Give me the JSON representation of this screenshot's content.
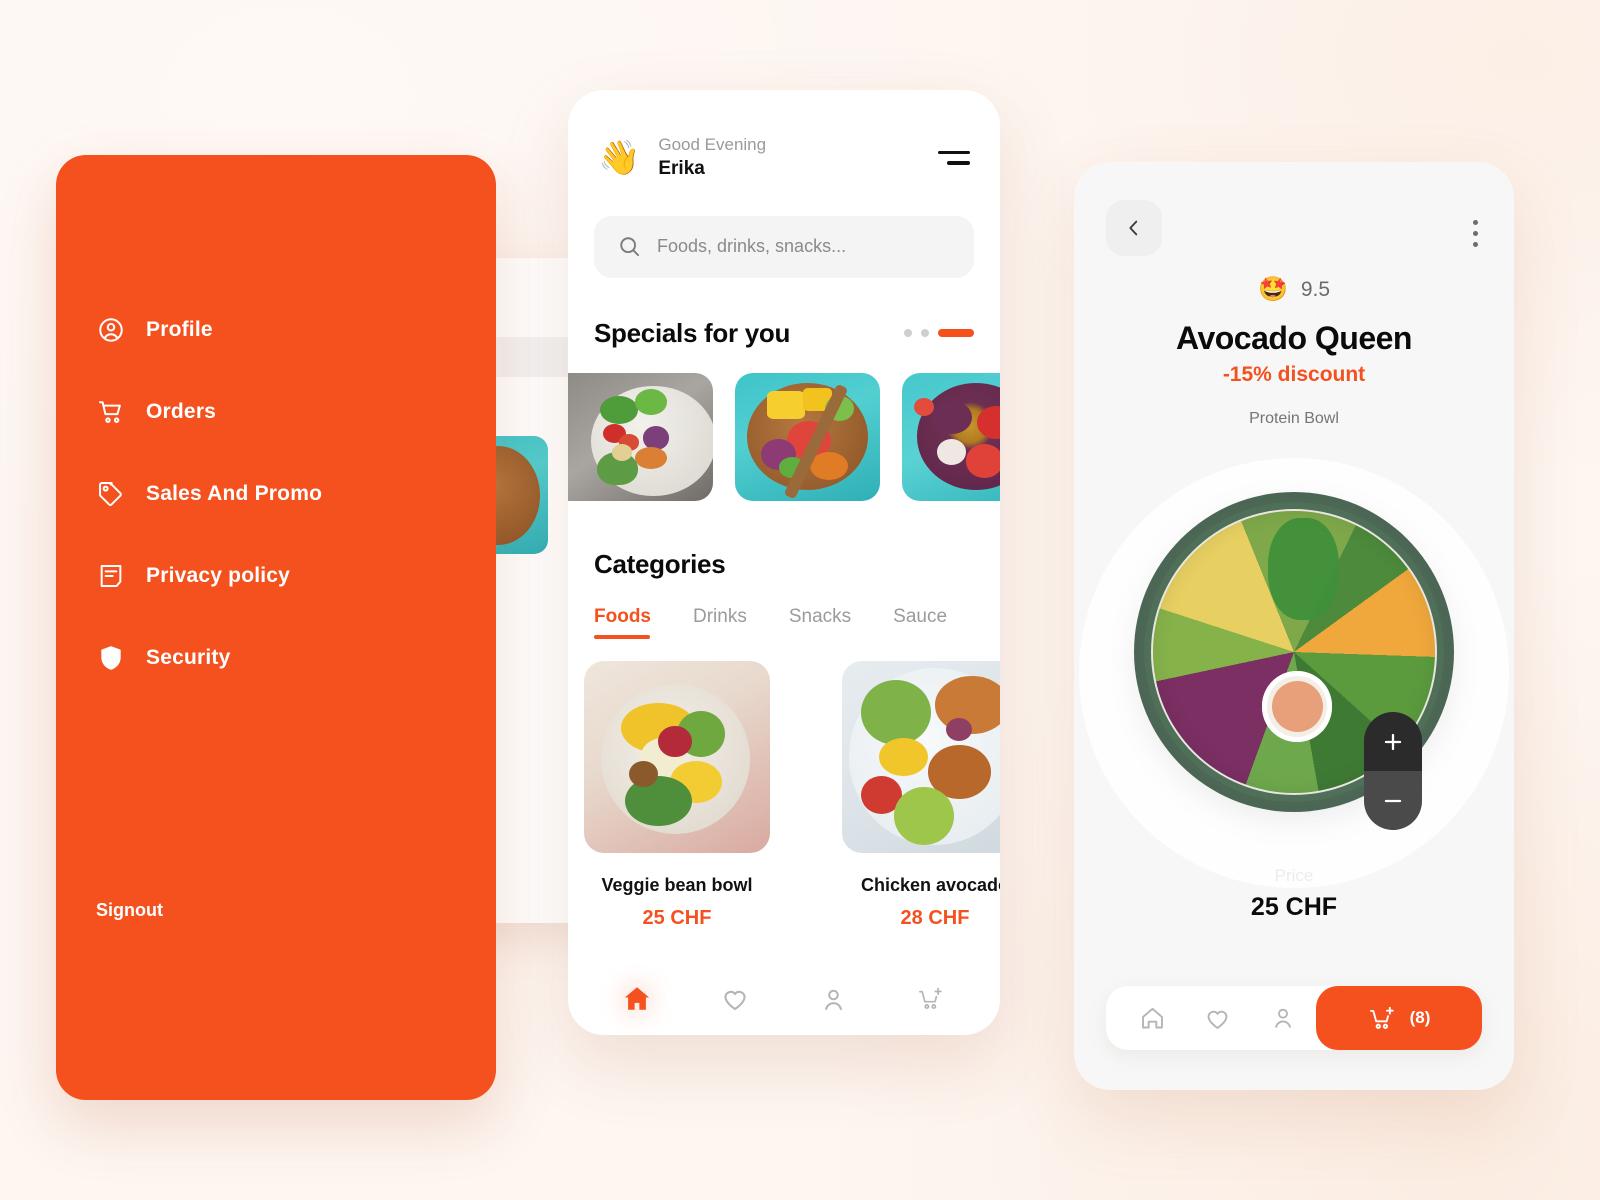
{
  "theme": {
    "accent": "#F4511E",
    "page_background": "#FDF6F1",
    "text_dark": "#0B0B0B",
    "text_muted": "#8A8A8A"
  },
  "sidebar": {
    "items": [
      {
        "label": "Profile",
        "icon": "user-circle-icon"
      },
      {
        "label": "Orders",
        "icon": "cart-icon"
      },
      {
        "label": "Sales And Promo",
        "icon": "tag-icon"
      },
      {
        "label": "Privacy policy",
        "icon": "document-icon"
      },
      {
        "label": "Security",
        "icon": "shield-icon"
      }
    ],
    "signout_label": "Signout"
  },
  "home": {
    "greeting_small": "Good Evening",
    "greeting_name": "Erika",
    "wave_emoji": "👋",
    "menu_icon": "hamburger-icon",
    "search": {
      "placeholder": "Foods, drinks, snacks...",
      "value": "",
      "icon": "search-icon"
    },
    "specials": {
      "title": "Specials for you",
      "pagination": {
        "dots": 2,
        "active_index": 2
      },
      "items": [
        {
          "name": "Mixed veggie salad bowl",
          "style": "img-salad"
        },
        {
          "name": "Tuna poke bowl",
          "style": "img-poke"
        },
        {
          "name": "Acai berry bowl",
          "style": "img-acai"
        }
      ]
    },
    "categories": {
      "title": "Categories",
      "tabs": [
        "Foods",
        "Drinks",
        "Snacks",
        "Sauce"
      ],
      "active_tab": "Foods",
      "cards": [
        {
          "name": "Veggie bean bowl",
          "price": "25 CHF",
          "style": "img-veggie"
        },
        {
          "name": "Chicken avocado",
          "price": "28 CHF",
          "style": "img-chicken"
        }
      ]
    },
    "bottom_nav": [
      {
        "icon": "home-icon",
        "active": true
      },
      {
        "icon": "heart-icon",
        "active": false
      },
      {
        "icon": "person-icon",
        "active": false
      },
      {
        "icon": "cart-add-icon",
        "active": false
      }
    ]
  },
  "detail": {
    "back_icon": "chevron-left-icon",
    "more_icon": "kebab-menu-icon",
    "rating_emoji": "🤩",
    "rating_value": "9.5",
    "title": "Avocado Queen",
    "discount": "-15% discount",
    "subtitle": "Protein Bowl",
    "stepper": {
      "increase_label": "+",
      "decrease_label": "−"
    },
    "price_label": "Price",
    "price_value": "25 CHF",
    "bottom_nav": [
      {
        "icon": "home-icon"
      },
      {
        "icon": "heart-icon"
      },
      {
        "icon": "person-icon"
      }
    ],
    "cart_button": {
      "icon": "cart-add-icon",
      "count": "(8)"
    }
  }
}
